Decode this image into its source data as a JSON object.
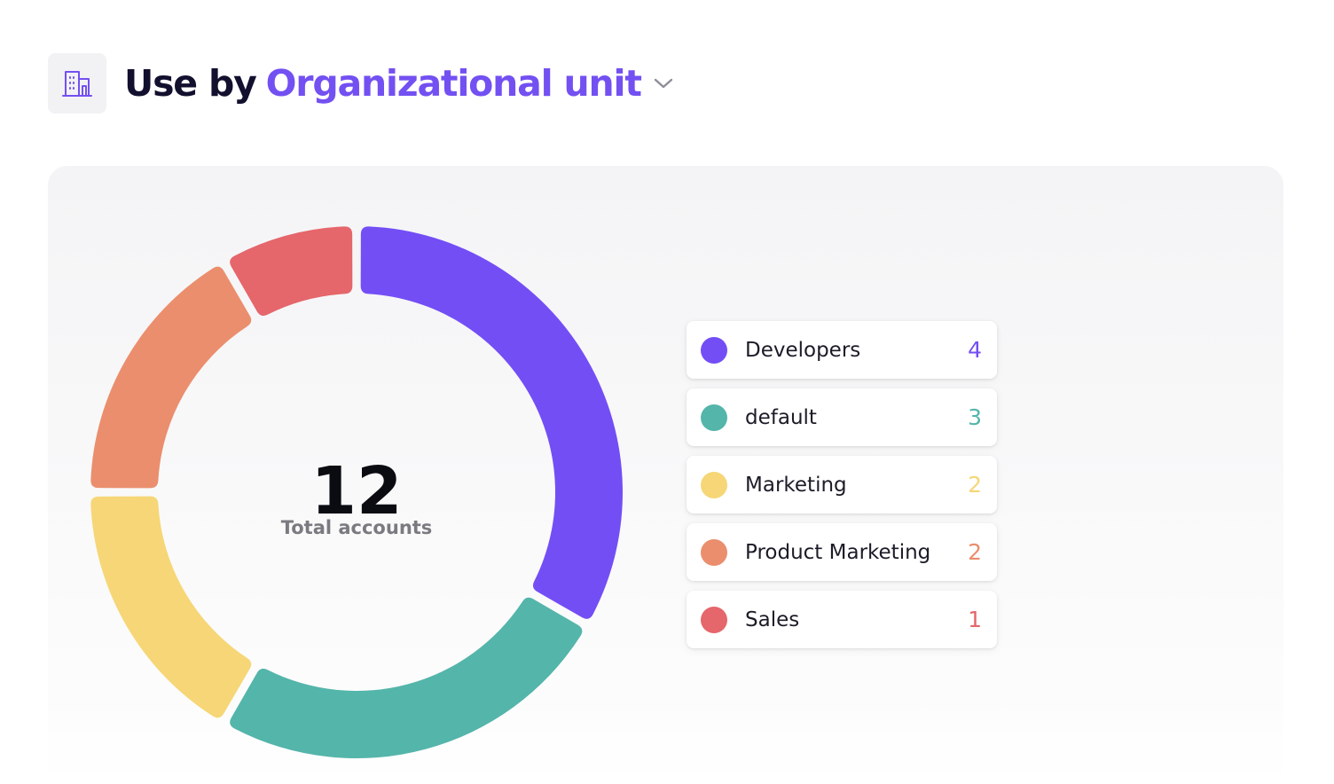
{
  "header": {
    "icon": "building-icon",
    "title_prefix": "Use by",
    "title_selector": "Organizational unit",
    "dropdown_icon": "chevron-down-icon"
  },
  "colors": {
    "accent": "#7350f2",
    "title": "#12102e"
  },
  "chart_data": {
    "type": "pie",
    "variant": "donut",
    "center_value": "12",
    "center_label": "Total accounts",
    "legend_position": "right",
    "slices": [
      {
        "label": "Developers",
        "value": 4,
        "color": "#734ef5"
      },
      {
        "label": "default",
        "value": 3,
        "color": "#54b5aa"
      },
      {
        "label": "Marketing",
        "value": 2,
        "color": "#f6d676"
      },
      {
        "label": "Product Marketing",
        "value": 2,
        "color": "#eb8e6d"
      },
      {
        "label": "Sales",
        "value": 1,
        "color": "#e5666b"
      }
    ]
  }
}
